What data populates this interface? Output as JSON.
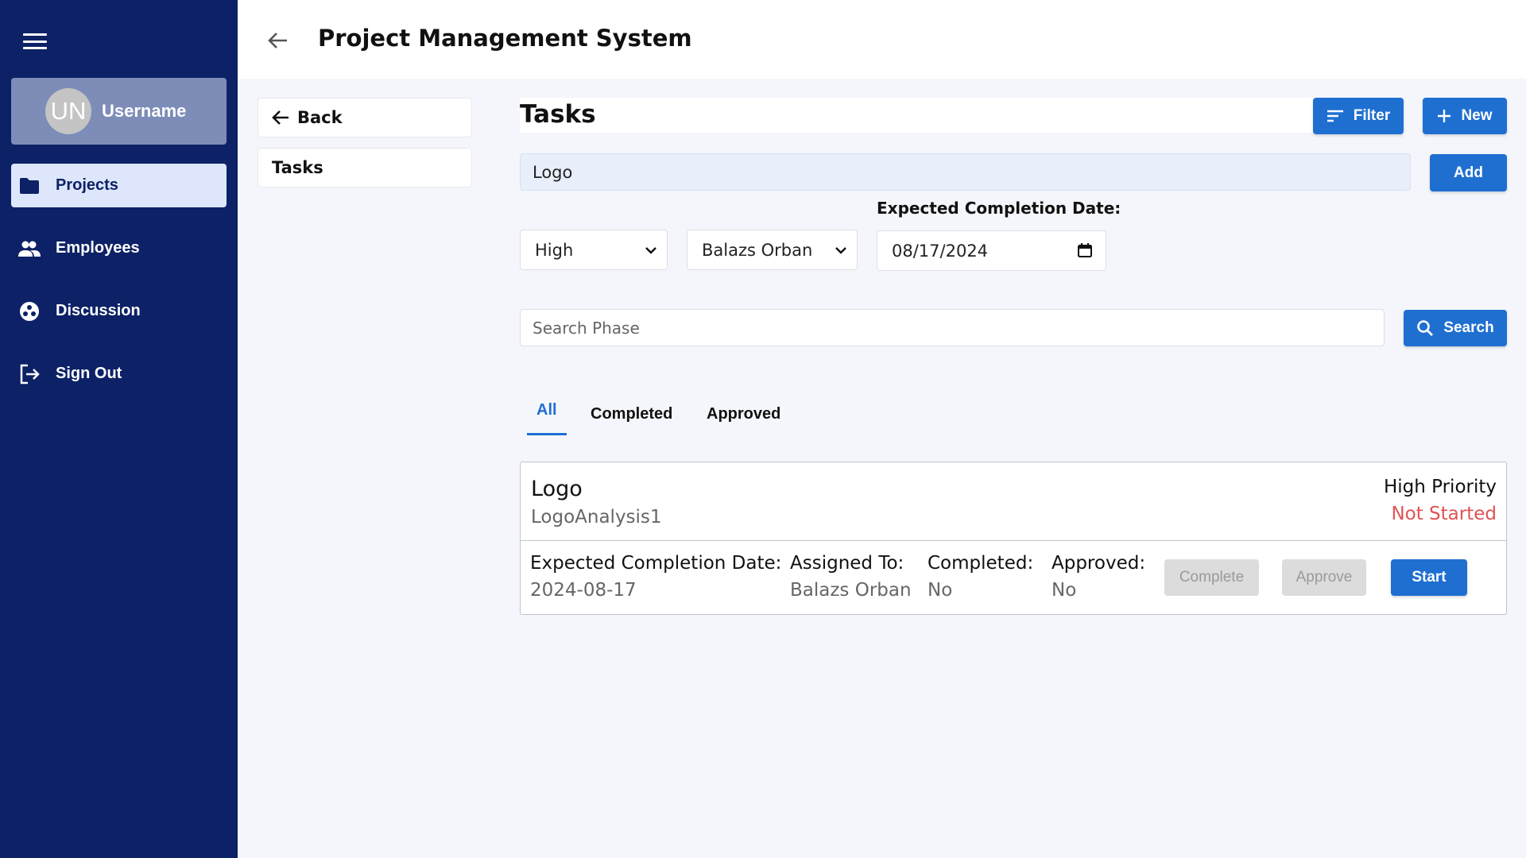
{
  "app": {
    "title": "Project Management System"
  },
  "sidebar": {
    "user": {
      "initials": "UN",
      "name": "Username"
    },
    "items": [
      {
        "label": "Projects",
        "icon": "folder-icon",
        "active": true
      },
      {
        "label": "Employees",
        "icon": "people-icon",
        "active": false
      },
      {
        "label": "Discussion",
        "icon": "discussion-icon",
        "active": false
      },
      {
        "label": "Sign Out",
        "icon": "sign-out-icon",
        "active": false
      }
    ]
  },
  "subnav": {
    "back_label": "Back",
    "tasks_label": "Tasks"
  },
  "main": {
    "title": "Tasks",
    "filter_label": "Filter",
    "new_label": "New",
    "task_name_value": "Logo",
    "add_label": "Add",
    "date_label": "Expected Completion Date:",
    "priority_selected": "High",
    "assignee_selected": "Balazs Orban",
    "date_value": "08/17/2024",
    "search_placeholder": "Search Phase",
    "search_label": "Search",
    "tabs": [
      {
        "label": "All",
        "active": true
      },
      {
        "label": "Completed",
        "active": false
      },
      {
        "label": "Approved",
        "active": false
      }
    ]
  },
  "task_card": {
    "name": "Logo",
    "phase": "LogoAnalysis1",
    "priority": "High Priority",
    "status": "Not Started",
    "expected_label": "Expected Completion Date:",
    "expected_value": "2024-08-17",
    "assigned_label": "Assigned To:",
    "assigned_value": "Balazs Orban",
    "completed_label": "Completed:",
    "completed_value": "No",
    "approved_label": "Approved:",
    "approved_value": "No",
    "complete_btn": "Complete",
    "approve_btn": "Approve",
    "start_btn": "Start"
  },
  "colors": {
    "sidebar": "#0d2166",
    "accent": "#1f6fd1",
    "status_not_started": "#e05252"
  }
}
